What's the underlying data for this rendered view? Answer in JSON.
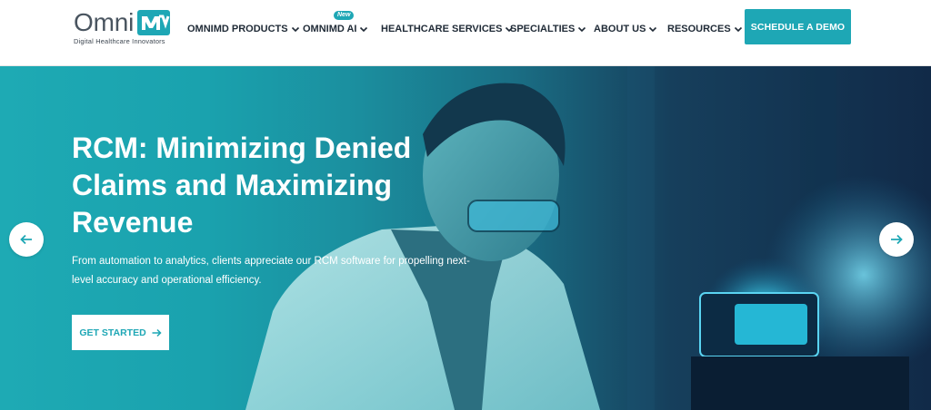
{
  "brand": {
    "name": "Omni",
    "tagline": "Digital Healthcare Innovators",
    "mark_color": "#1ea7b5"
  },
  "nav": {
    "items": [
      {
        "label": "OMNIMD PRODUCTS"
      },
      {
        "label": "OMNIMD AI",
        "badge": "New"
      },
      {
        "label": "HEALTHCARE SERVICES"
      },
      {
        "label": "SPECIALTIES"
      },
      {
        "label": "ABOUT US"
      },
      {
        "label": "RESOURCES"
      }
    ],
    "cta_label": "SCHEDULE A DEMO"
  },
  "hero": {
    "title_lines": [
      "RCM: Minimizing Denied",
      "Claims and Maximizing",
      "Revenue"
    ],
    "description_lines": [
      "From automation to analytics, clients appreciate our RCM software for propelling next-",
      "level accuracy and operational efficiency."
    ],
    "button_label": "GET STARTED",
    "prev_icon": "arrow-left-icon",
    "next_icon": "arrow-right-icon",
    "image_description_icon": "scientist-lab-photo"
  },
  "colors": {
    "accent": "#1ea7b5",
    "nav_text": "#1f2a36",
    "hero_dark": "#112a48"
  }
}
